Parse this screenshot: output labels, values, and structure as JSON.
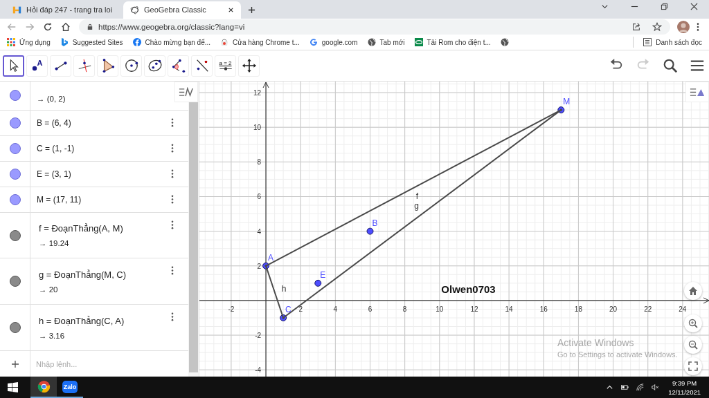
{
  "browser": {
    "tabs": [
      {
        "kind": "hoidap",
        "title": "Hỏi đáp 247 - trang tra loi",
        "selected": false
      },
      {
        "kind": "geogebra",
        "title": "GeoGebra Classic",
        "selected": true
      }
    ],
    "url": "https://www.geogebra.org/classic?lang=vi",
    "bookmarks": [
      {
        "kind": "apps",
        "label": "Ứng dụng"
      },
      {
        "kind": "bing",
        "label": "Suggested Sites"
      },
      {
        "kind": "facebook",
        "label": "Chào mừng bạn để..."
      },
      {
        "kind": "store",
        "label": "Cửa hàng Chrome t..."
      },
      {
        "kind": "google",
        "label": "google.com"
      },
      {
        "kind": "globe",
        "label": "Tab mới"
      },
      {
        "kind": "rom",
        "label": "Tải Rom cho điện t..."
      },
      {
        "kind": "globe"
      }
    ],
    "reading_list": "Danh sách đọc"
  },
  "toolbar": {
    "tools": [
      {
        "kind": "move",
        "selected": true
      },
      {
        "kind": "point",
        "text": "A",
        "selected": false
      },
      {
        "kind": "segment",
        "selected": false
      },
      {
        "kind": "perpendicular",
        "selected": false
      },
      {
        "kind": "polygon",
        "selected": false
      },
      {
        "kind": "circle",
        "selected": false
      },
      {
        "kind": "conic",
        "selected": false
      },
      {
        "kind": "angle",
        "selected": false
      },
      {
        "kind": "reflect",
        "selected": false
      },
      {
        "kind": "slider",
        "text": "a = 2",
        "selected": false
      },
      {
        "kind": "pan",
        "selected": false
      }
    ]
  },
  "algebra": {
    "items": [
      {
        "kind": "point",
        "color": "#9a9aff",
        "value": "→ (0, 2)"
      },
      {
        "kind": "point",
        "color": "#9a9aff",
        "definition": "B = (6, 4)"
      },
      {
        "kind": "point",
        "color": "#9a9aff",
        "definition": "C = (1, -1)"
      },
      {
        "kind": "point",
        "color": "#9a9aff",
        "definition": "E = (3, 1)"
      },
      {
        "kind": "point",
        "color": "#9a9aff",
        "definition": "M = (17, 11)"
      },
      {
        "kind": "segment",
        "color": "#8a8a8a",
        "definition": "f = ĐoạnThẳng(A, M)",
        "value": "→ 19.24"
      },
      {
        "kind": "segment",
        "color": "#8a8a8a",
        "definition": "g = ĐoạnThẳng(M, C)",
        "value": "→ 20"
      },
      {
        "kind": "segment",
        "color": "#8a8a8a",
        "definition": "h = ĐoạnThẳng(C, A)",
        "value": "→ 3.16"
      }
    ],
    "input_placeholder": "Nhập lệnh..."
  },
  "graphics": {
    "chart_data": {
      "type": "scatter",
      "xlim": [
        -3.83,
        25.56
      ],
      "ylim": [
        -4.39,
        12.64
      ],
      "xticks": [
        -2,
        2,
        4,
        6,
        8,
        10,
        12,
        14,
        16,
        18,
        20,
        22,
        24
      ],
      "yticks": [
        -4,
        -2,
        2,
        4,
        6,
        8,
        10,
        12
      ],
      "grid": true,
      "x": [
        0,
        1,
        3,
        6,
        17
      ],
      "series": [
        {
          "name": "f",
          "type": "line",
          "color": "#4a4a4a",
          "values": [
            2,
            null,
            null,
            null,
            11
          ]
        },
        {
          "name": "g",
          "type": "line",
          "color": "#4a4a4a",
          "values": [
            null,
            -1,
            null,
            null,
            11
          ]
        },
        {
          "name": "h",
          "type": "line",
          "color": "#4a4a4a",
          "values": [
            2,
            -1,
            null,
            null,
            null
          ]
        },
        {
          "name": "A",
          "color": "#4d4dff",
          "values": [
            2,
            null,
            null,
            null,
            null
          ]
        },
        {
          "name": "B",
          "color": "#4d4dff",
          "values": [
            null,
            null,
            null,
            4,
            null
          ]
        },
        {
          "name": "C",
          "color": "#4d4dff",
          "values": [
            null,
            -1,
            null,
            null,
            null
          ]
        },
        {
          "name": "E",
          "color": "#4d4dff",
          "values": [
            null,
            null,
            1,
            null,
            null
          ]
        },
        {
          "name": "M",
          "color": "#4d4dff",
          "values": [
            null,
            null,
            null,
            null,
            11
          ]
        }
      ],
      "annotations": [
        {
          "text": "Olwen0703"
        }
      ]
    }
  },
  "activation": {
    "title": "Activate Windows",
    "subtitle": "Go to Settings to activate Windows."
  },
  "taskbar": {
    "apps": [
      {
        "kind": "chrome",
        "selected": true
      },
      {
        "kind": "zalo",
        "text": "Zalo",
        "selected": false
      }
    ],
    "time": "9:39 PM",
    "date": "12/11/2021"
  }
}
